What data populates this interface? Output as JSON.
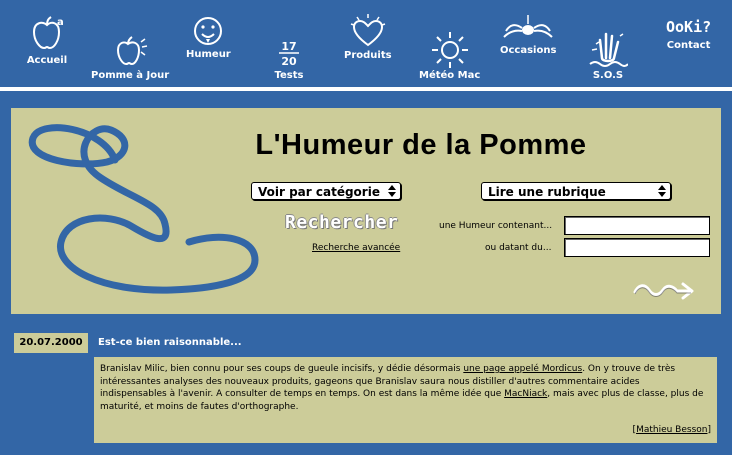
{
  "nav": {
    "items": [
      {
        "label": "Accueil"
      },
      {
        "label": "Pomme à Jour"
      },
      {
        "label": "Humeur"
      },
      {
        "label": "Tests"
      },
      {
        "label": "Produits"
      },
      {
        "label": "Météo Mac"
      },
      {
        "label": "Occasions"
      },
      {
        "label": "S.O.S"
      },
      {
        "label": "Contact"
      }
    ],
    "icon_texts": {
      "apple_sup": "a",
      "tests_top": "17",
      "tests_bottom": "20",
      "contact_logo": "OoKi?"
    }
  },
  "banner": {
    "title": "L'Humeur de la Pomme",
    "category_select": "Voir par catégorie",
    "rubrique_select": "Lire une rubrique",
    "search_title": "Rechercher",
    "advanced_link": "Recherche avancée",
    "label_contains": "une Humeur contenant...",
    "label_date": "ou datant du...",
    "input_contains_value": "",
    "input_date_value": ""
  },
  "news": {
    "date": "20.07.2000",
    "title": "Est-ce bien raisonnable...",
    "body_1": "Branislav Milic, bien connu pour ses coups de gueule incisifs, y dédie désormais ",
    "link_1": "une page appelé Mordicus",
    "body_2": ". On y trouve de très intéressantes analyses des nouveaux produits, gageons que Branislav saura nous distiller d'autres commentaire acides indispensables à l'avenir. A consulter de temps en temps. On est dans la même idée que ",
    "link_2": "MacNiack",
    "body_3": ", mais avec plus de classe, plus de maturité, et moins de fautes d'orthographe.",
    "author_open": "[",
    "author": "Mathieu Besson",
    "author_close": "]"
  },
  "colors": {
    "background": "#3366a6",
    "panel": "#cccc99",
    "swirl": "#3366a6"
  }
}
